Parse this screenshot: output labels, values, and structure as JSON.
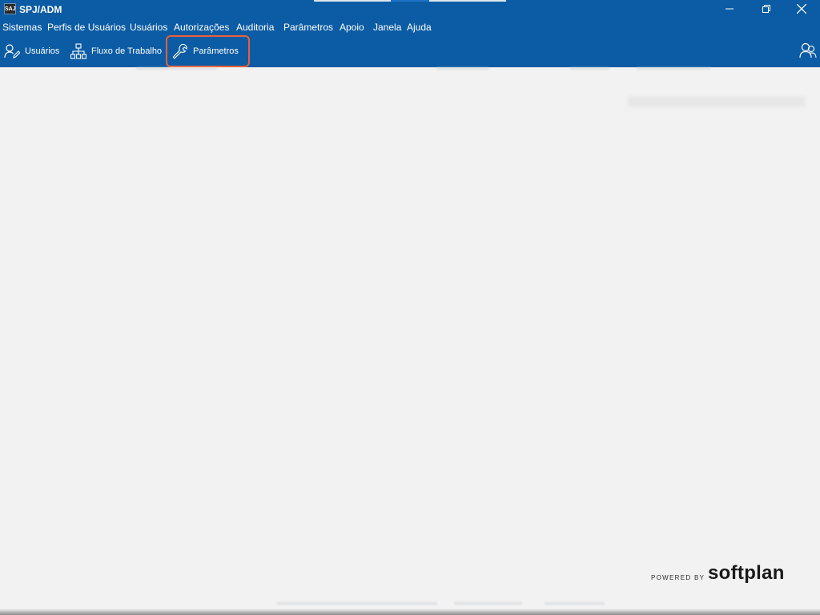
{
  "window": {
    "app_icon_text": "SAJ",
    "title": "SPJ/ADM",
    "controls": [
      "minimize",
      "restore",
      "close"
    ]
  },
  "menubar": {
    "items": [
      "Sistemas",
      "Perfis de Usuários",
      "Usuários",
      "Autorizações",
      "Auditoria",
      "Parâmetros",
      "Apoio",
      "Janela",
      "Ajuda"
    ]
  },
  "toolbar": {
    "buttons": [
      {
        "label": "Usuários",
        "icon": "user-edit-icon"
      },
      {
        "label": "Fluxo de Trabalho",
        "icon": "workflow-icon"
      },
      {
        "label": "Parâmetros",
        "icon": "wrench-icon",
        "highlighted": true
      }
    ],
    "right_icon": "users-icon"
  },
  "footer": {
    "powered_by": "POWERED BY",
    "brand": "softplan"
  },
  "colors": {
    "header_blue": "#0b5ca4",
    "highlight_orange": "#e8603c",
    "background": "#f2f2f2"
  }
}
